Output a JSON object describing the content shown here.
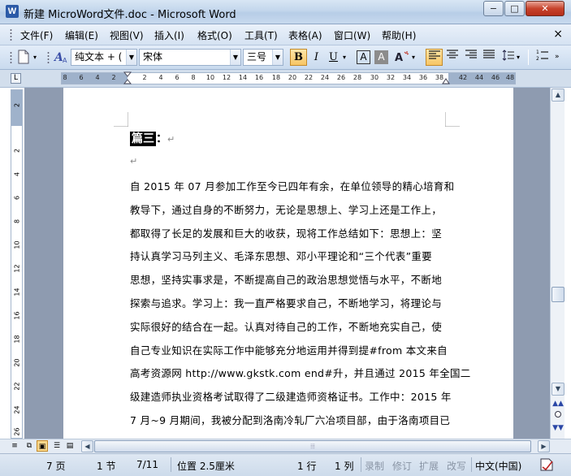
{
  "window": {
    "title": "新建 MicroWord文件.doc - Microsoft Word",
    "app_icon": "W",
    "minimize": "−",
    "maximize": "□",
    "close": "✕"
  },
  "menu": {
    "items": [
      "文件(F)",
      "编辑(E)",
      "视图(V)",
      "插入(I)",
      "格式(O)",
      "工具(T)",
      "表格(A)",
      "窗口(W)",
      "帮助(H)"
    ],
    "doc_close": "×"
  },
  "toolbar": {
    "style_value": "纯文本 + (",
    "font_value": "宋体",
    "size_value": "三号",
    "bold": "B",
    "italic": "I",
    "underline": "U",
    "char_border": "A",
    "char_shading": "A"
  },
  "ruler": {
    "corner": "L",
    "numbers": [
      "8",
      "6",
      "4",
      "2",
      "2",
      "4",
      "6",
      "8",
      "10",
      "12",
      "14",
      "16",
      "18",
      "20",
      "22",
      "24",
      "26",
      "28",
      "30",
      "32",
      "34",
      "36",
      "38",
      "42",
      "44",
      "46",
      "48"
    ],
    "vertical_numbers": [
      "2",
      "2",
      "4",
      "6",
      "8",
      "10",
      "12",
      "14",
      "16",
      "18",
      "20",
      "22",
      "24",
      "26"
    ]
  },
  "document": {
    "heading": "篇三",
    "heading_colon": "：",
    "para_mark": "↵",
    "lines": [
      "自 2015 年 07 月参加工作至今已四年有余，在单位领导的精心培育和",
      "教导下，通过自身的不断努力，无论是思想上、学习上还是工作上，",
      "都取得了长足的发展和巨大的收获，现将工作总结如下：思想上：坚",
      "持认真学习马列主义、毛泽东思想、邓小平理论和“三个代表”重要",
      "思想，坚持实事求是，不断提高自己的政治思想觉悟与水平，不断地",
      "探索与追求。学习上：我一直严格要求自己，不断地学习，将理论与",
      "实际很好的结合在一起。认真对待自己的工作，不断地充实自己，使",
      "自己专业知识在实际工作中能够充分地运用并得到提#from 本文来自",
      "高考资源网 http://www.gkstk.com end#升，并且通过 2015 年全国二",
      "级建造师执业资格考试取得了二级建造师资格证书。工作中：2015 年",
      "7 月~9 月期间，我被分配到洛南冷轧厂六冶项目部，由于洛南项目已"
    ]
  },
  "status": {
    "page": "7 页",
    "section": "1 节",
    "page_of": "7/11",
    "position": "位置 2.5厘米",
    "line": "1 行",
    "column": "1 列",
    "rec": "录制",
    "trk": "修订",
    "ext": "扩展",
    "ovr": "改写",
    "language": "中文(中国)"
  },
  "icons": {
    "new_doc": "new-document-icon",
    "styles": "styles-icon",
    "scroll_up": "▲",
    "scroll_down": "▼",
    "scroll_left": "◀",
    "scroll_right": "▶"
  }
}
